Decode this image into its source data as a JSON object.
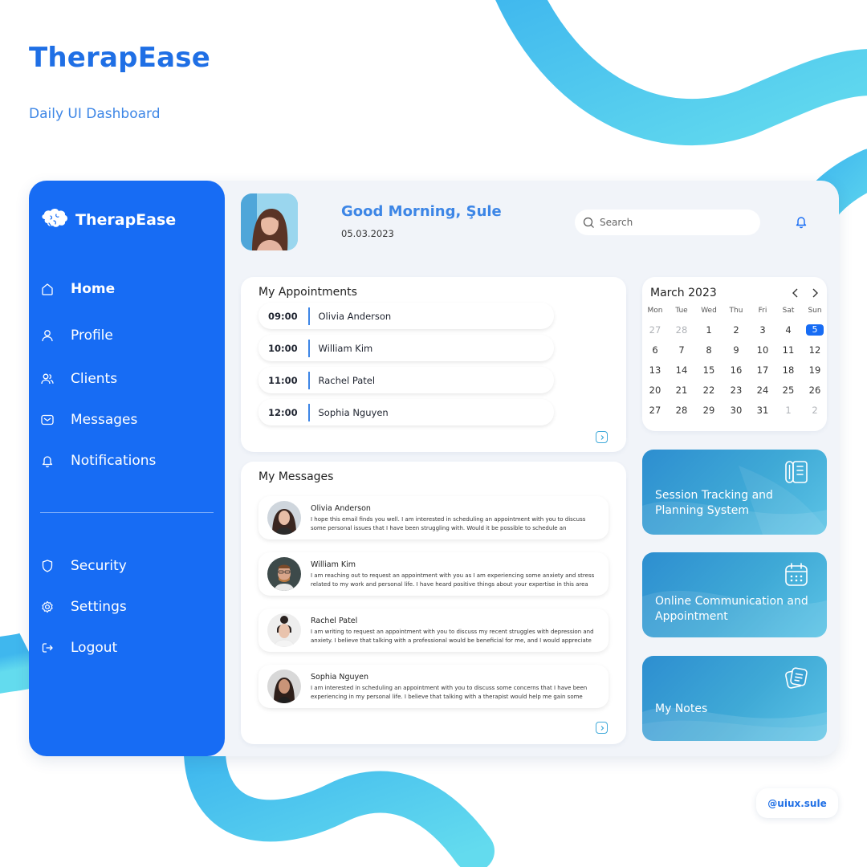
{
  "brand": {
    "title": "TherapEase",
    "subtitle": "Daily UI Dashboard"
  },
  "sidebar": {
    "logo_text": "TherapEase",
    "nav": [
      {
        "label": "Home",
        "icon": "home-icon"
      },
      {
        "label": "Profile",
        "icon": "user-icon"
      },
      {
        "label": "Clients",
        "icon": "users-icon"
      },
      {
        "label": "Messages",
        "icon": "mail-icon"
      },
      {
        "label": "Notifications",
        "icon": "bell-icon"
      }
    ],
    "secondary": [
      {
        "label": "Security",
        "icon": "shield-icon"
      },
      {
        "label": "Settings",
        "icon": "gear-icon"
      },
      {
        "label": "Logout",
        "icon": "logout-icon"
      }
    ]
  },
  "header": {
    "greeting": "Good Morning, Şule",
    "date": "05.03.2023",
    "search_placeholder": "Search"
  },
  "appointments": {
    "title": "My Appointments",
    "items": [
      {
        "time": "09:00",
        "name": "Olivia Anderson"
      },
      {
        "time": "10:00",
        "name": "William Kim"
      },
      {
        "time": "11:00",
        "name": "Rachel Patel"
      },
      {
        "time": "12:00",
        "name": "Sophia Nguyen"
      }
    ]
  },
  "messages": {
    "title": "My Messages",
    "items": [
      {
        "name": "Olivia Anderson",
        "text": "I hope this email finds you well. I am interested in scheduling an appointment with you to discuss some personal issues that I have been struggling with. Would it be possible to schedule an appointment with you"
      },
      {
        "name": "William Kim",
        "text": "I am reaching out to request an appointment with you as I am experiencing some anxiety and stress related to my work and personal life. I have heard positive things about your expertise in this area and believe that you"
      },
      {
        "name": "Rachel Patel",
        "text": "I am writing to request an appointment with you to discuss my recent struggles with depression and anxiety. I believe that talking with a professional would be beneficial for me, and I would appreciate your help in this"
      },
      {
        "name": "Sophia Nguyen",
        "text": "I am interested in scheduling an appointment with you to discuss some concerns that I have been experiencing in my personal life. I believe that talking with a therapist would help me gain some clarity and"
      }
    ]
  },
  "calendar": {
    "title": "March 2023",
    "weekdays": [
      "Mon",
      "Tue",
      "Wed",
      "Thu",
      "Fri",
      "Sat",
      "Sun"
    ],
    "weeks": [
      [
        "27",
        "28",
        "1",
        "2",
        "3",
        "4",
        "5"
      ],
      [
        "6",
        "7",
        "8",
        "9",
        "10",
        "11",
        "12"
      ],
      [
        "13",
        "14",
        "15",
        "16",
        "17",
        "18",
        "19"
      ],
      [
        "20",
        "21",
        "22",
        "23",
        "24",
        "25",
        "26"
      ],
      [
        "27",
        "28",
        "29",
        "30",
        "31",
        "1",
        "2"
      ]
    ],
    "selected": "5"
  },
  "features": [
    {
      "label": "Session Tracking and Planning System",
      "icon": "notebook-icon"
    },
    {
      "label": "Online Communication and Appointment",
      "icon": "calendar-icon"
    },
    {
      "label": "My Notes",
      "icon": "notes-icon"
    }
  ],
  "credit": "@uiux.sule",
  "colors": {
    "primary": "#176cf4",
    "brand_text": "#1f6fe5",
    "accent": "#3d86e6",
    "card_teal": "#3fa9d6"
  }
}
